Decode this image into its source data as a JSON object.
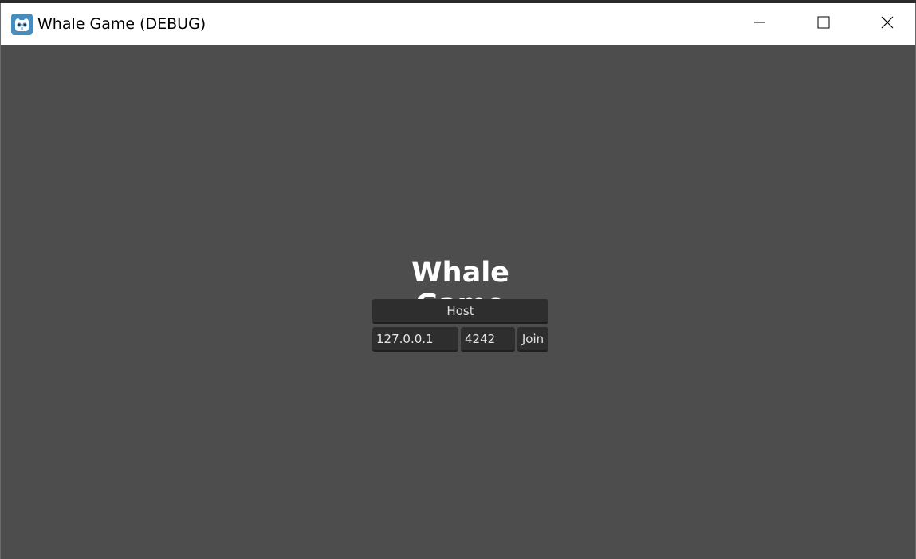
{
  "window": {
    "title": "Whale Game (DEBUG)",
    "icon": "godot-icon"
  },
  "controls": {
    "minimize_icon": "minimize-icon",
    "maximize_icon": "maximize-icon",
    "close_icon": "close-icon"
  },
  "menu": {
    "game_title": "Whale Game",
    "host_label": "Host",
    "ip_value": "127.0.0.1",
    "port_value": "4242",
    "join_label": "Join"
  },
  "colors": {
    "background": "#4d4d4d",
    "button": "#2e2e2e",
    "titlebar": "#ffffff",
    "icon_blue": "#478cbf"
  }
}
